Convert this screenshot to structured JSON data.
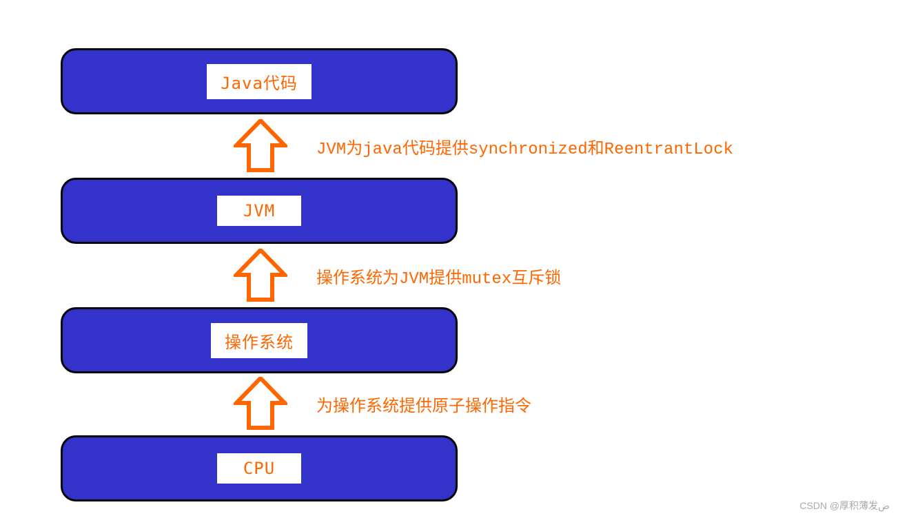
{
  "layers": {
    "java": {
      "label": "Java代码"
    },
    "jvm": {
      "label": "JVM"
    },
    "os": {
      "label": "操作系统"
    },
    "cpu": {
      "label": "CPU"
    }
  },
  "annotations": {
    "a1": "JVM为java代码提供synchronized和ReentrantLock",
    "a2": "操作系统为JVM提供mutex互斥锁",
    "a3": "为操作系统提供原子操作指令"
  },
  "watermark": "CSDN @厚积薄发ض"
}
